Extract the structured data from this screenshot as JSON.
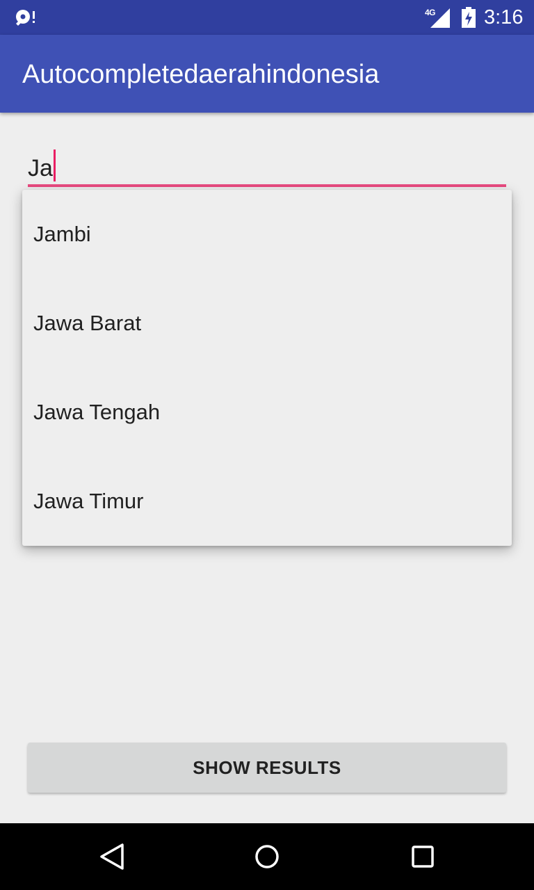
{
  "status_bar": {
    "network_label": "4G",
    "time": "3:16",
    "left_icon": "sync-disk-notification-icon",
    "signal_icon": "signal-icon",
    "battery_icon": "battery-charging-icon"
  },
  "app_bar": {
    "title": "Autocompletedaerahindonesia"
  },
  "input": {
    "value": "Ja"
  },
  "suggestions": [
    "Jambi",
    "Jawa Barat",
    "Jawa Tengah",
    "Jawa Timur"
  ],
  "button": {
    "label": "SHOW RESULTS"
  },
  "nav_bar": {
    "back_icon": "back-icon",
    "home_icon": "home-icon",
    "recents_icon": "recents-icon"
  },
  "colors": {
    "status_bar": "#303f9f",
    "app_bar": "#3f51b5",
    "accent": "#e91e63",
    "background": "#eeeeee",
    "button": "#d6d7d7"
  }
}
